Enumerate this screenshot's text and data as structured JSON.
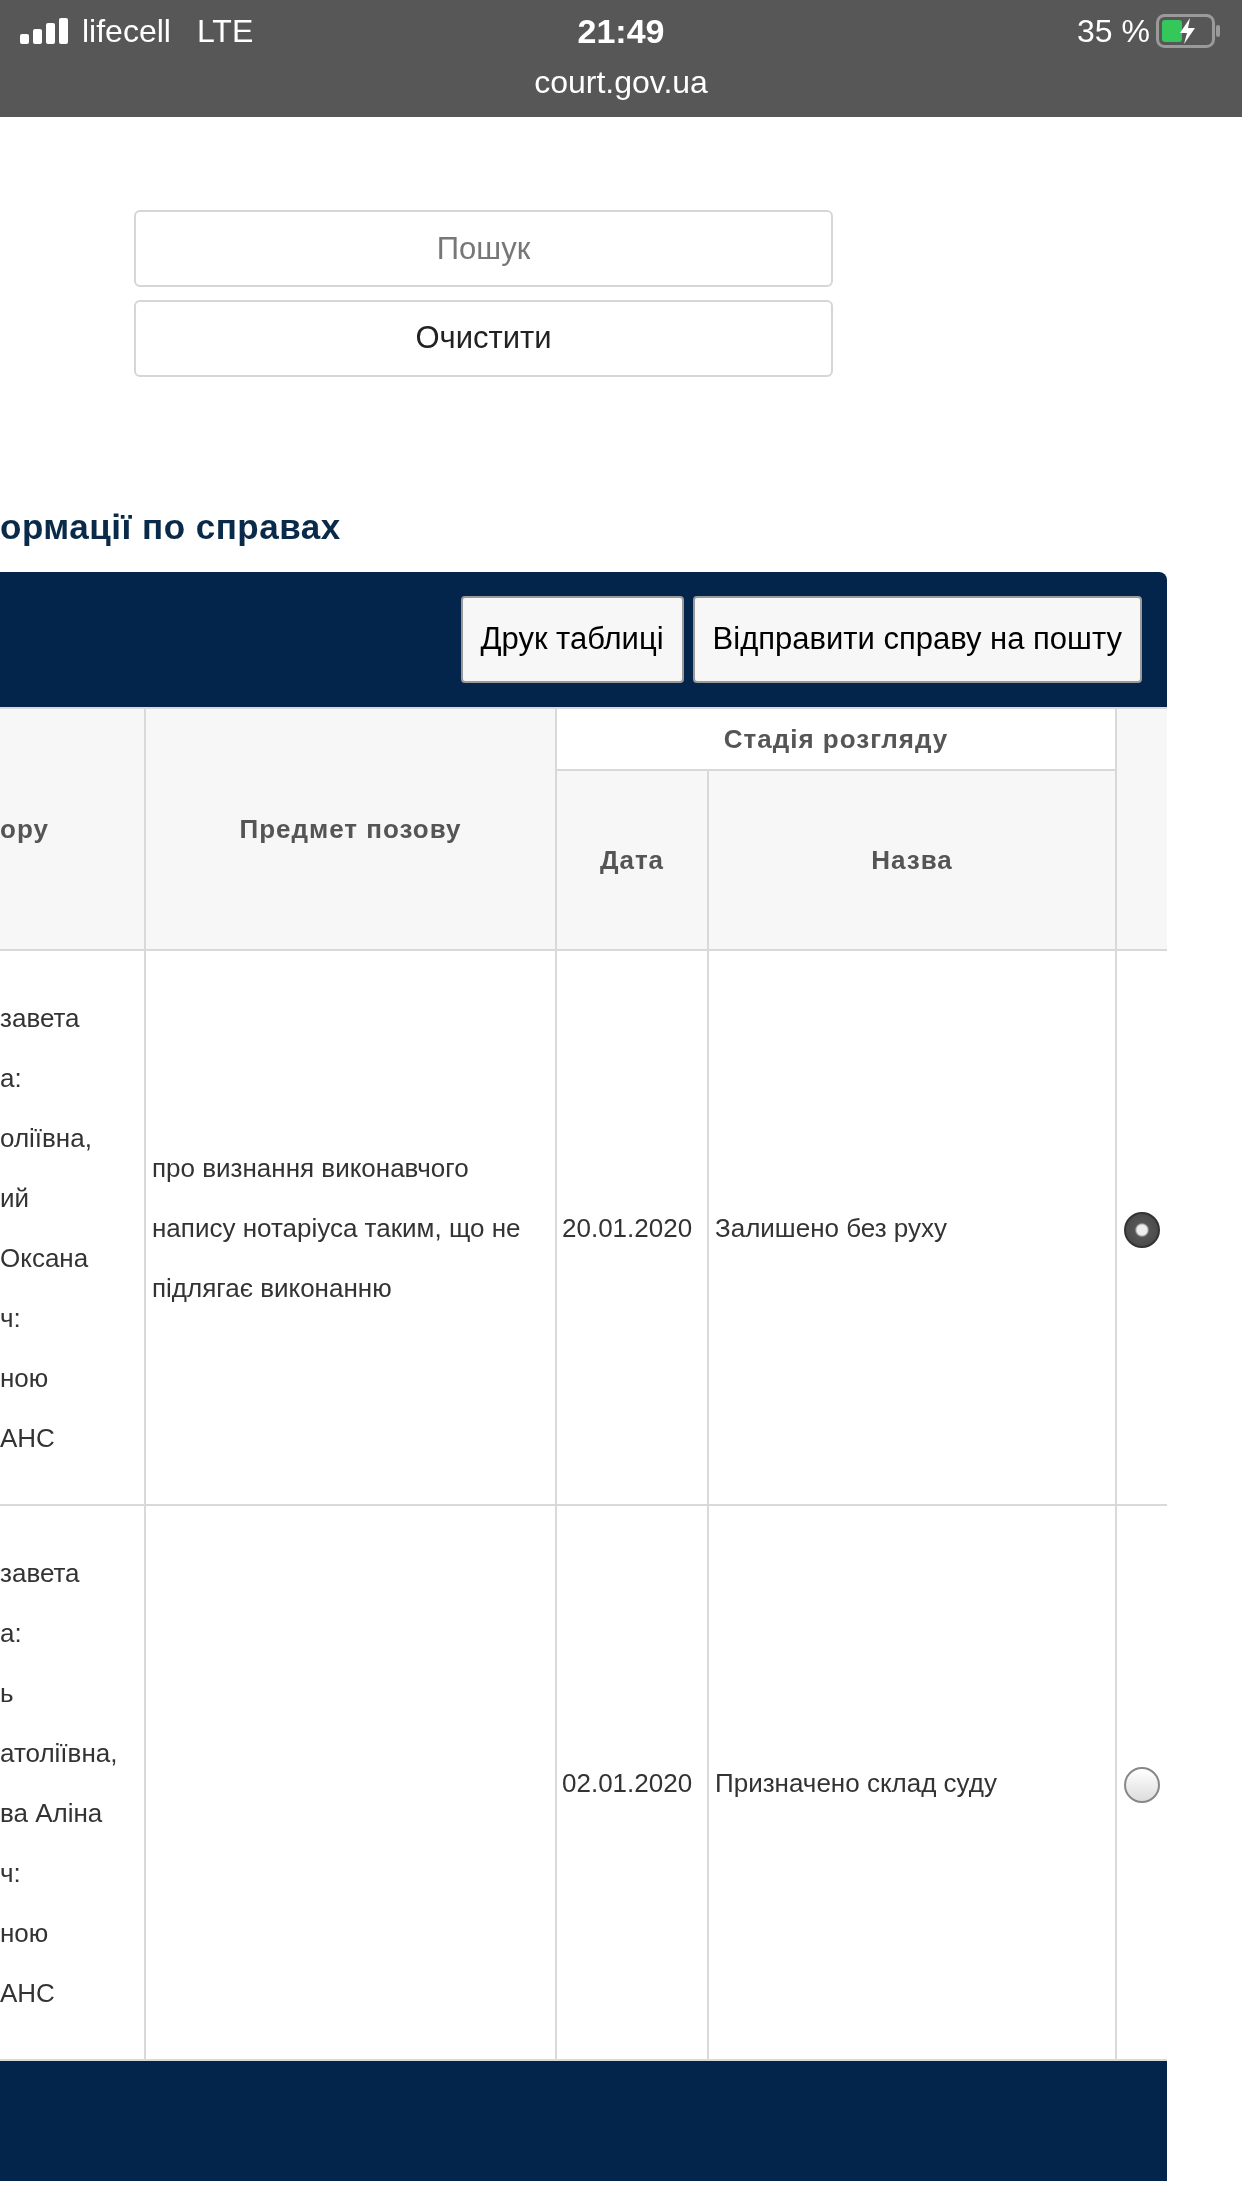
{
  "status_bar": {
    "carrier": "lifecell",
    "network": "LTE",
    "time": "21:49",
    "battery": "35 %",
    "url": "court.gov.ua"
  },
  "search": {
    "placeholder": "Пошук",
    "clear_button": "Очистити"
  },
  "heading": "ормації по справах",
  "toolbar": {
    "buttons": [
      "Друк таблиці",
      "Відправити справу на пошту"
    ]
  },
  "table": {
    "columns": {
      "column_1": "ору",
      "subject": "Предмет позову",
      "stage": "Стадія розгляду",
      "date": "Дата",
      "name": "Назва"
    },
    "rows": [
      {
        "column_1": [
          "завета",
          "а:",
          "оліївна,",
          "ий",
          "Оксана",
          "ч:",
          "ною",
          "АНС"
        ],
        "subject": "про визнання виконавчого напису нотаріуса таким, що не підлягає виконанню",
        "date": "20.01.2020",
        "stage_name": "Залишено без руху",
        "selected": true
      },
      {
        "column_1": [
          "завета",
          "а:",
          "ь",
          "атоліївна,",
          "ва Аліна",
          "ч:",
          "ною",
          "АНС"
        ],
        "subject": "",
        "date": "02.01.2020",
        "stage_name": "Призначено склад суду",
        "selected": false
      }
    ]
  }
}
